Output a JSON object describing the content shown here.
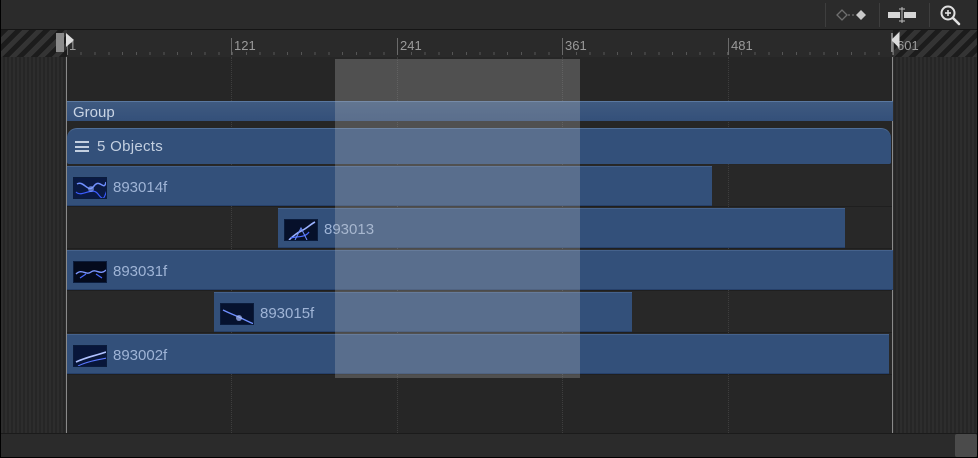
{
  "toolbar": {
    "buttons": [
      {
        "name": "keyframe-navigation-icon"
      },
      {
        "name": "snapping-icon"
      },
      {
        "name": "zoom-icon"
      }
    ]
  },
  "ruler": {
    "ticks": [
      "1",
      "121",
      "241",
      "361",
      "481",
      "601"
    ]
  },
  "group": {
    "label": "Group"
  },
  "layer": {
    "label": "5 Objects"
  },
  "clips": [
    {
      "label": "893014f"
    },
    {
      "label": "893013"
    },
    {
      "label": "893031f"
    },
    {
      "label": "893015f"
    },
    {
      "label": "893002f"
    }
  ],
  "colors": {
    "clip": "#33507a",
    "group": "#3f5a80",
    "background": "#232323",
    "selection": "#bebebe"
  }
}
